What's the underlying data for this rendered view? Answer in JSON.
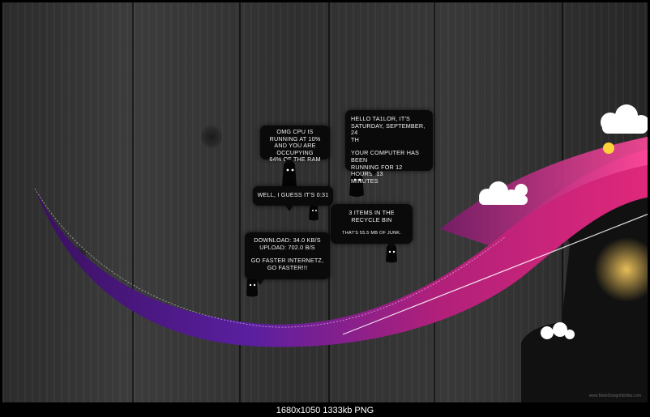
{
  "bubbles": {
    "cpu": "OMG CPU IS RUNNING AT 10%\nAND YOU ARE OCCUPYING\n64% OF THE RAM",
    "greeting": {
      "line1": "HELLO TA1LOR, IT'S\nSATURDAY, SEPTEMBER, 24\nTH",
      "line2": "YOUR COMPUTER HAS BEEN\nRUNNING FOR 12 HOURS, 13\nMINUTES"
    },
    "time": "WELL, I GUESS IT'S 0:31",
    "recycle": {
      "items": "3 ITEMS IN THE\nRECYCLE BIN",
      "junk": "THAT'S 55.5 MB OF JUNK."
    },
    "network": {
      "speeds": "DOWNLOAD: 34.0 KB/S\nUPLOAD: 702.0 B/S",
      "message": "GO FASTER INTERNETZ,\nGO FASTER!!!"
    }
  },
  "watermark": "www.MaloDesignNoWar.com",
  "status": "1680x1050  1333kb  PNG",
  "colors": {
    "ribbon_pink": "#e0287a",
    "ribbon_purple": "#5a1fa0",
    "wood": "#333333"
  }
}
